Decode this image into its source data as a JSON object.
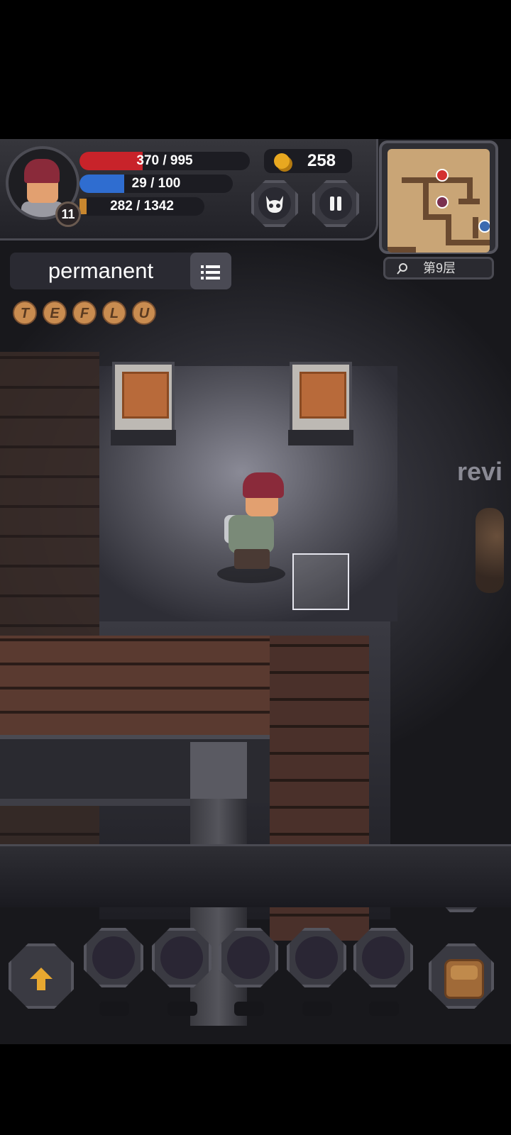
{
  "hud": {
    "level": "11",
    "hp_text": "370 / 995",
    "hp_fraction": 0.372,
    "mp_text": "29 / 100",
    "mp_fraction": 0.29,
    "xp_text": "282 / 1342",
    "gold": "258",
    "floor_label": "第9层",
    "colors": {
      "hp": "#c8232a",
      "mp": "#2f6dd0",
      "xp": "#c8862e"
    }
  },
  "buff": {
    "title": "permanent",
    "menu_icon": "list-icon"
  },
  "runes": [
    "T",
    "E",
    "F",
    "L",
    "U"
  ],
  "scene": {
    "floating_text": "revi"
  },
  "buttons": {
    "monster_icon": "devil-icon",
    "pause_icon": "pause-icon",
    "hammer_icon": "hammer-icon",
    "level_up_icon": "arrow-up-icon",
    "bag_icon": "backpack-icon"
  },
  "skill_slots": [
    {
      "label": ""
    },
    {
      "label": ""
    },
    {
      "label": ""
    },
    {
      "label": ""
    },
    {
      "label": ""
    }
  ]
}
